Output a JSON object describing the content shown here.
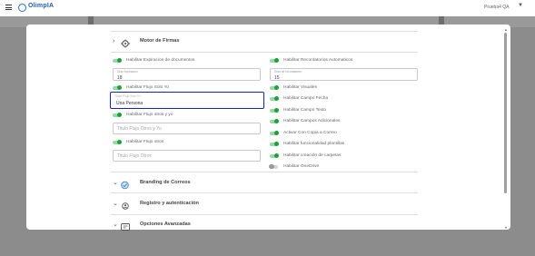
{
  "app": {
    "logo_text": "OlimpIA",
    "user_name": "Prueba4 QA"
  },
  "sections": {
    "motor_firmas": "Motor de Firmas",
    "branding": "Branding de Correos",
    "registro": "Registro y autenticación",
    "opciones": "Opciones Avanzadas"
  },
  "left": {
    "habilitar_expiracion": "Habilitar Expiracion de documentos",
    "dias_expiracion_label": "Días expiración",
    "dias_expiracion_value": "18",
    "habilitar_flujo_solo_yo": "Habilitar Flujo Solo Yo",
    "titulo_solo_yo_label": "Título Flujo Solo Yo",
    "titulo_solo_yo_value": "Una Persona",
    "habilitar_flujo_otros_y_yo": "Habilitar Flujo otros y yo",
    "titulo_otros_y_yo_placeholder": "Titulo Flujo Otros y Yo",
    "habilitar_flujo_otros": "Habilitar Flujo otros",
    "titulo_otros_placeholder": "Titulo Flujo Otros"
  },
  "right": {
    "habilitar_recordatorios": "Habilitar Recordatorios Automaticos",
    "dias_recordatorio_label": "Días de recordatorio",
    "dias_recordatorio_value": "15",
    "habilitar_visuales": "Habilitar Visuales",
    "habilitar_campo_fecha": "Habilitar Campo Fecha",
    "habilitar_campo_texto": "Habilitar Campo Texto",
    "habilitar_campos_adicionales": "Habilitar Campos Adicionales",
    "activar_copia_correo": "Activar Con Copia a Correo",
    "habilitar_plantillas": "Habilitar funcionalidad plantillas",
    "habilitar_carpetas": "Habilitar creación de carpetas",
    "habilitar_onedrive": "Habilitar OneDrive"
  },
  "colors": {
    "brand": "#1f73c6",
    "toggle_on": "#1aa333",
    "focus_border": "#1626b8"
  }
}
